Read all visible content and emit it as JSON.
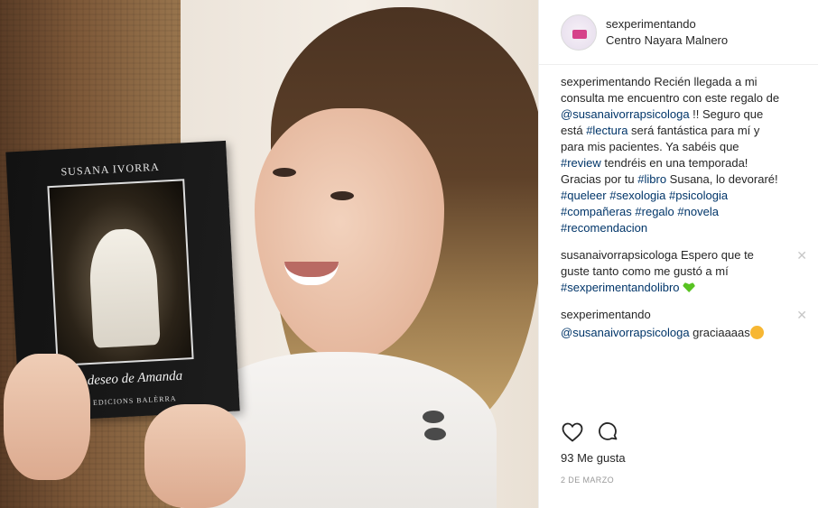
{
  "photo": {
    "book": {
      "author": "SUSANA IVORRA",
      "title": "El deseo de Amanda",
      "publisher": "EDICIONS BALÈRRA"
    }
  },
  "header": {
    "username": "sexperimentando",
    "location": "Centro Nayara Malnero"
  },
  "caption": {
    "user": "sexperimentando",
    "parts": [
      {
        "t": "Recién llegada a mi consulta me encuentro con este regalo de ",
        "tag": false
      },
      {
        "t": "@susanaivorrapsicologa",
        "tag": true
      },
      {
        "t": " !! Seguro que está ",
        "tag": false
      },
      {
        "t": "#lectura",
        "tag": true
      },
      {
        "t": " será fantástica para mí y para mis pacientes. Ya sabéis que ",
        "tag": false
      },
      {
        "t": "#review",
        "tag": true
      },
      {
        "t": " tendréis en una temporada!",
        "tag": false
      },
      {
        "t": "\nGracias por tu ",
        "tag": false
      },
      {
        "t": "#libro",
        "tag": true
      },
      {
        "t": " Susana, lo devoraré!\n",
        "tag": false
      },
      {
        "t": "#queleer",
        "tag": true
      },
      {
        "t": " ",
        "tag": false
      },
      {
        "t": "#sexologia",
        "tag": true
      },
      {
        "t": " ",
        "tag": false
      },
      {
        "t": "#psicologia",
        "tag": true
      },
      {
        "t": "\n",
        "tag": false
      },
      {
        "t": "#compañeras",
        "tag": true
      },
      {
        "t": " ",
        "tag": false
      },
      {
        "t": "#regalo",
        "tag": true
      },
      {
        "t": " ",
        "tag": false
      },
      {
        "t": "#novela",
        "tag": true
      },
      {
        "t": "\n",
        "tag": false
      },
      {
        "t": "#recomendacion",
        "tag": true
      }
    ]
  },
  "comments": [
    {
      "user": "susanaivorrapsicologa",
      "text": " Espero que te guste tanto como me gustó a mí ",
      "tag": "#sexperimentandolibro",
      "emoji": "green-heart-icon",
      "close": "✕"
    },
    {
      "user": "sexperimentando",
      "mention": "@susanaivorrapsicologa",
      "text": " graciaaaas",
      "emoji": "kissing-face-icon",
      "close": "✕"
    }
  ],
  "likes": {
    "count_label": "93 Me gusta"
  },
  "date_label": "2 DE MARZO",
  "colors": {
    "link": "#003569",
    "text": "#262626",
    "muted": "#999999",
    "green_heart": "#58c322"
  }
}
